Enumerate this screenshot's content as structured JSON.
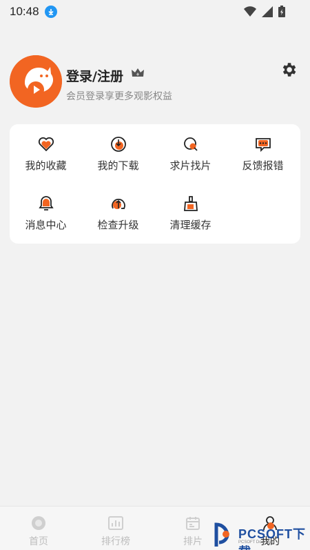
{
  "status_bar": {
    "time": "10:48"
  },
  "profile": {
    "title": "登录/注册",
    "subtitle": "会员登录享更多观影权益"
  },
  "grid": [
    {
      "label": "我的收藏",
      "icon": "heart-icon"
    },
    {
      "label": "我的下载",
      "icon": "download-icon"
    },
    {
      "label": "求片找片",
      "icon": "search-film-icon"
    },
    {
      "label": "反馈报错",
      "icon": "feedback-icon"
    },
    {
      "label": "消息中心",
      "icon": "bell-icon"
    },
    {
      "label": "检查升级",
      "icon": "upgrade-icon"
    },
    {
      "label": "清理缓存",
      "icon": "broom-icon"
    }
  ],
  "tabbar": [
    {
      "label": "首页",
      "icon": "home-icon"
    },
    {
      "label": "排行榜",
      "icon": "ranking-icon"
    },
    {
      "label": "排片",
      "icon": "calendar-icon"
    },
    {
      "label": "我的",
      "icon": "profile-icon"
    }
  ],
  "watermark": {
    "brand": "PCSOFT下载",
    "sub": "PCSOFT Download"
  },
  "colors": {
    "accent": "#f26522",
    "background": "#f2f2f2",
    "card": "#ffffff"
  }
}
